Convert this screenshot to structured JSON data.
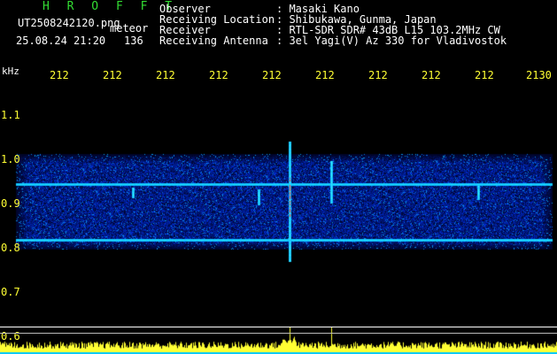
{
  "header": {
    "station_title": "H R O F F T",
    "file_name": "UT2508242120.png",
    "event_label": "meteor",
    "date_time": "25.08.24 21:20",
    "count": "136",
    "fields": [
      {
        "label": "Observer",
        "value": ": Masaki Kano"
      },
      {
        "label": "Receiving Location",
        "value": ": Shibukawa, Gunma, Japan"
      },
      {
        "label": "Receiver",
        "value": ": RTL-SDR SDR# 43dB L15 103.2MHz CW"
      },
      {
        "label": "Receiving Antenna",
        "value": ": 3el Yagi(V) Az 330 for Vladivostok"
      }
    ]
  },
  "time_axis": {
    "ticks": [
      "212",
      "212",
      "212",
      "212",
      "212",
      "212",
      "212",
      "212",
      "212",
      "2130"
    ]
  },
  "freq_axis": {
    "unit": "kHz",
    "ticks": [
      "1.1",
      "1.0",
      "0.9",
      "0.8",
      "0.7",
      "0.6"
    ]
  },
  "colors": {
    "background": "#000000",
    "noise_low": "#000a5a",
    "noise_mid": "#1e3cc8",
    "signal_line": "#4ec8ff",
    "meteor": "#ff3030",
    "level_bar": "#ffff33",
    "level_base": "#00c8ff",
    "title_green": "#33dd33"
  }
}
